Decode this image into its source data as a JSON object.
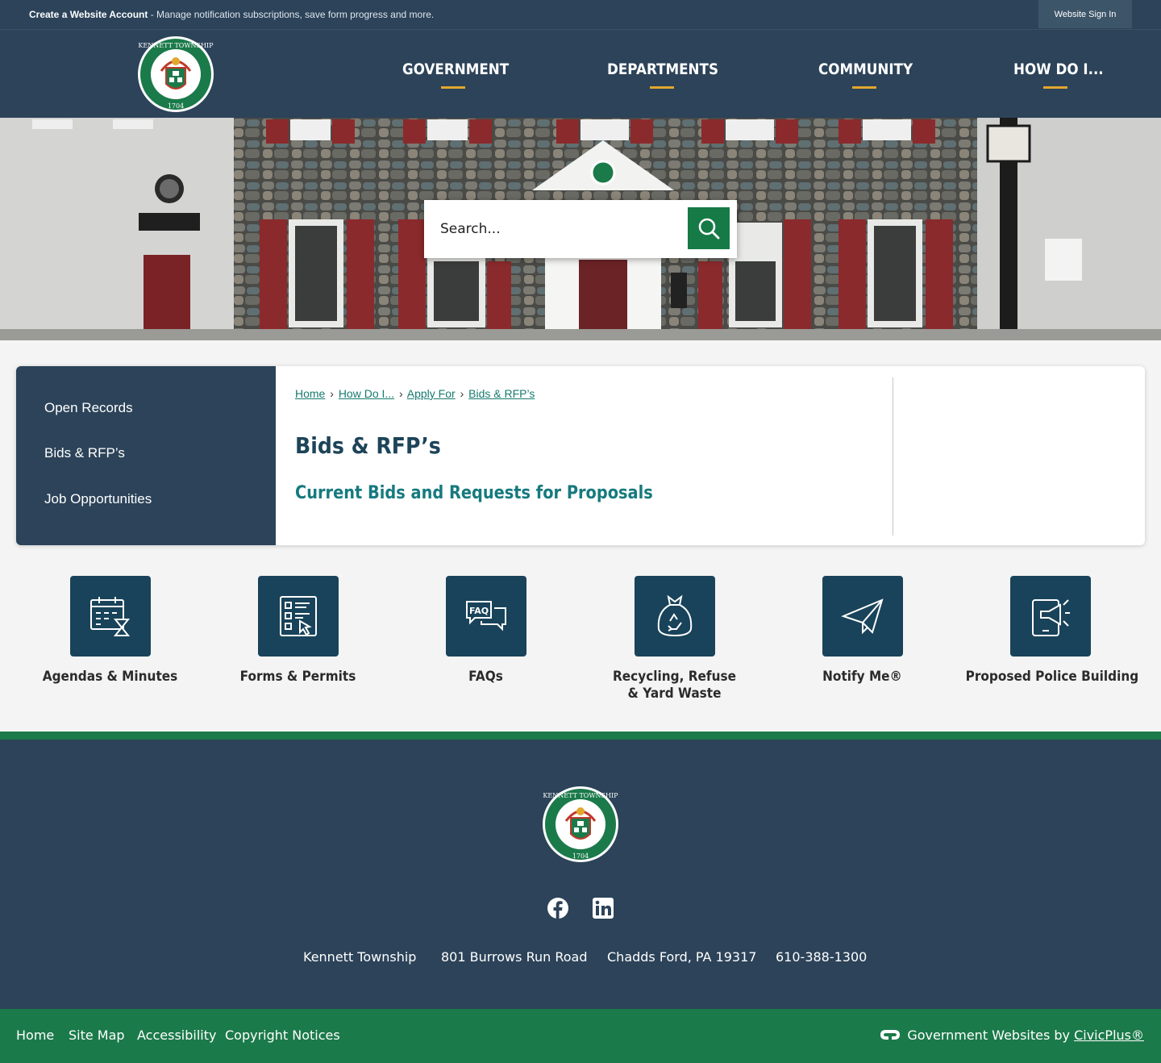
{
  "topbar": {
    "account_bold": "Create a Website Account",
    "account_text": " - Manage notification subscriptions, save form progress and more.",
    "signin_label": "Website Sign In"
  },
  "header": {
    "logo_alt": "Kennett Township 1704 seal",
    "nav": [
      "GOVERNMENT",
      "DEPARTMENTS",
      "COMMUNITY",
      "HOW DO I..."
    ]
  },
  "search": {
    "placeholder": "Search...",
    "button_icon": "search-icon"
  },
  "sidebar": {
    "items": [
      "Open Records",
      "Bids & RFP’s",
      "Job Opportunities"
    ]
  },
  "breadcrumb": {
    "items": [
      "Home",
      "How Do I...",
      "Apply For",
      "Bids & RFP’s"
    ],
    "separator": "›"
  },
  "main": {
    "title": "Bids & RFP’s",
    "subhead": "Current Bids and Requests for Proposals"
  },
  "quick_links": [
    {
      "label": "Agendas & Minutes",
      "icon": "calendar-hourglass-icon"
    },
    {
      "label": "Forms & Permits",
      "icon": "form-checklist-icon"
    },
    {
      "label": "FAQs",
      "icon": "faq-chat-icon"
    },
    {
      "label_line1": "Recycling, Refuse",
      "label_line2": "& Yard Waste",
      "icon": "recycling-bag-icon"
    },
    {
      "label": "Notify Me®",
      "icon": "paper-plane-icon"
    },
    {
      "label": "Proposed Police Building",
      "icon": "tablet-megaphone-icon"
    }
  ],
  "footer": {
    "social": [
      "facebook-icon",
      "linkedin-icon"
    ],
    "address": [
      "Kennett Township",
      "801 Burrows Run Road",
      "Chadds Ford, PA 19317",
      "610-388-1300"
    ],
    "links": [
      "Home",
      "Site Map",
      "Accessibility",
      "Copyright Notices"
    ],
    "credit_text": "Government Websites by ",
    "credit_link": "CivicPlus®"
  },
  "colors": {
    "navy": "#2c4359",
    "green": "#1b7a4a",
    "accent_gold": "#e2a72e",
    "teal_text": "#167a7e",
    "tile": "#19435a"
  }
}
